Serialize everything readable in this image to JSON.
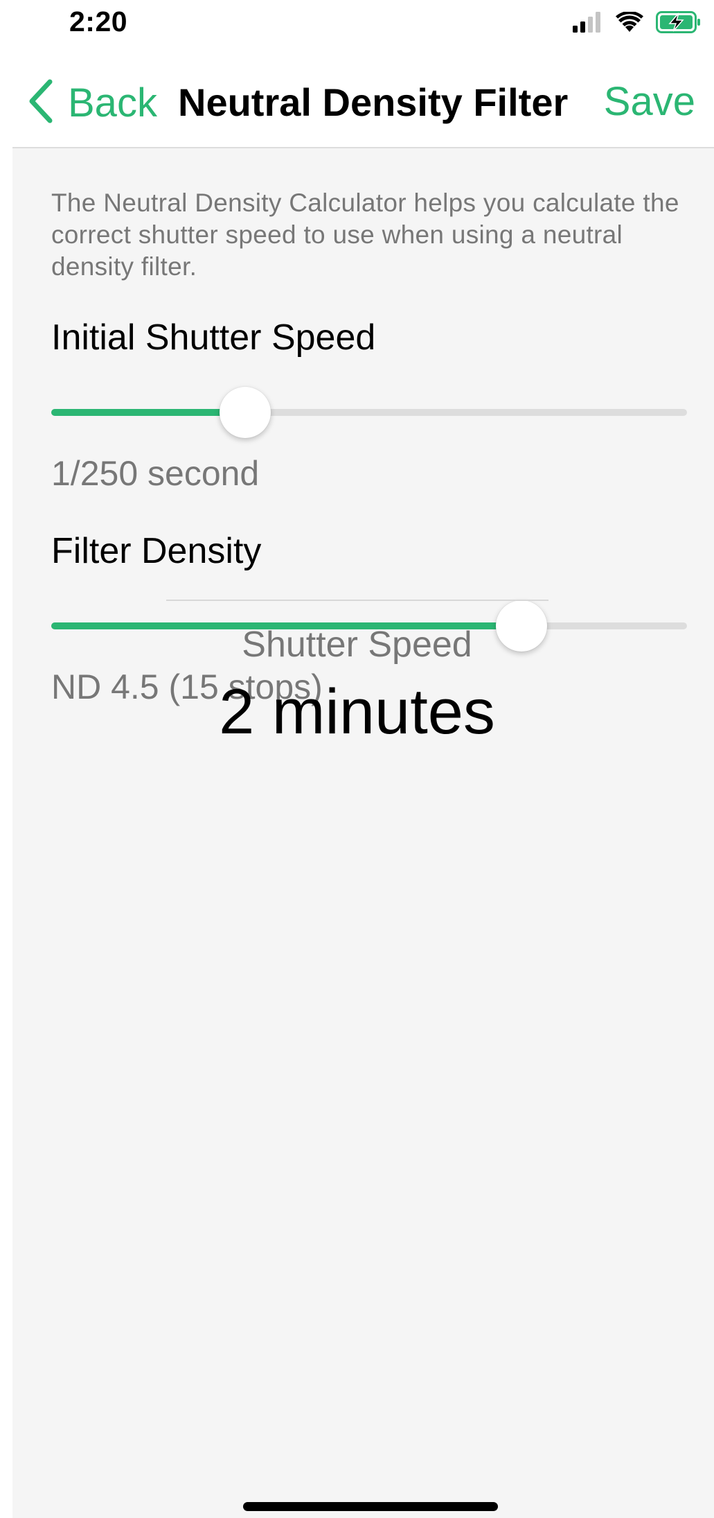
{
  "status_bar": {
    "time": "2:20",
    "icons": [
      "cellular-signal-icon",
      "wifi-icon",
      "battery-charging-icon"
    ]
  },
  "nav": {
    "back_label": "Back",
    "title": "Neutral Density Filter",
    "save_label": "Save"
  },
  "description": "The Neutral Density Calculator helps you calculate the correct shutter speed to use when using a neutral density filter.",
  "initial_shutter": {
    "label": "Initial Shutter Speed",
    "value_text": "1/250 second",
    "slider_level": 0.305
  },
  "filter_density": {
    "label": "Filter Density",
    "value_text": "ND 4.5 (15 stops)",
    "slider_level": 0.74
  },
  "result": {
    "label": "Shutter Speed",
    "value": "2 minutes"
  },
  "colors": {
    "accent": "#2bb673",
    "content_background": "#f5f5f5",
    "secondary_text": "#777777"
  }
}
